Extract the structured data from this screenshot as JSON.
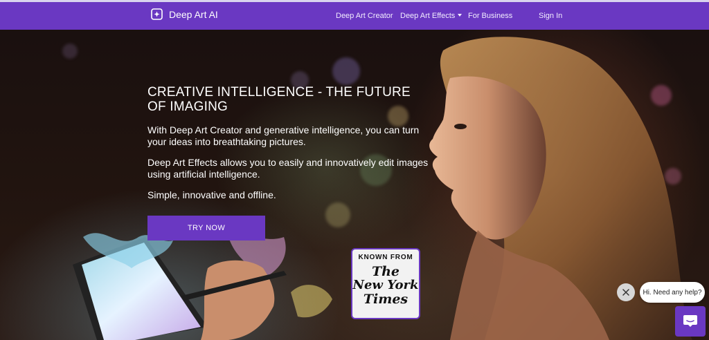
{
  "brand": {
    "name": "Deep Art AI",
    "icon": "sparkle-square-icon"
  },
  "nav": {
    "links": [
      {
        "label": "Deep Art Creator"
      },
      {
        "label": "Deep Art Effects",
        "has_dropdown": true
      },
      {
        "label": "For Business"
      },
      {
        "label": "Sign In"
      }
    ]
  },
  "hero": {
    "title": "CREATIVE INTELLIGENCE - THE FUTURE OF IMAGING",
    "paragraphs": [
      "With Deep Art Creator and generative intelligence, you can turn your ideas into breathtaking pictures.",
      "Deep Art Effects allows you to easily and innovatively edit images using artificial intelligence.",
      "Simple, innovative and offline."
    ],
    "cta_label": "TRY NOW"
  },
  "press_badge": {
    "heading": "KNOWN FROM",
    "logo_line1": "The",
    "logo_line2": "New York",
    "logo_line3": "Times"
  },
  "chat": {
    "greeting": "Hi. Need any help?",
    "close_icon": "close-icon",
    "launcher_icon": "chat-icon"
  },
  "colors": {
    "brand_purple": "#6a38c2",
    "text_white": "#ffffff",
    "hero_dark": "#1a100f"
  }
}
